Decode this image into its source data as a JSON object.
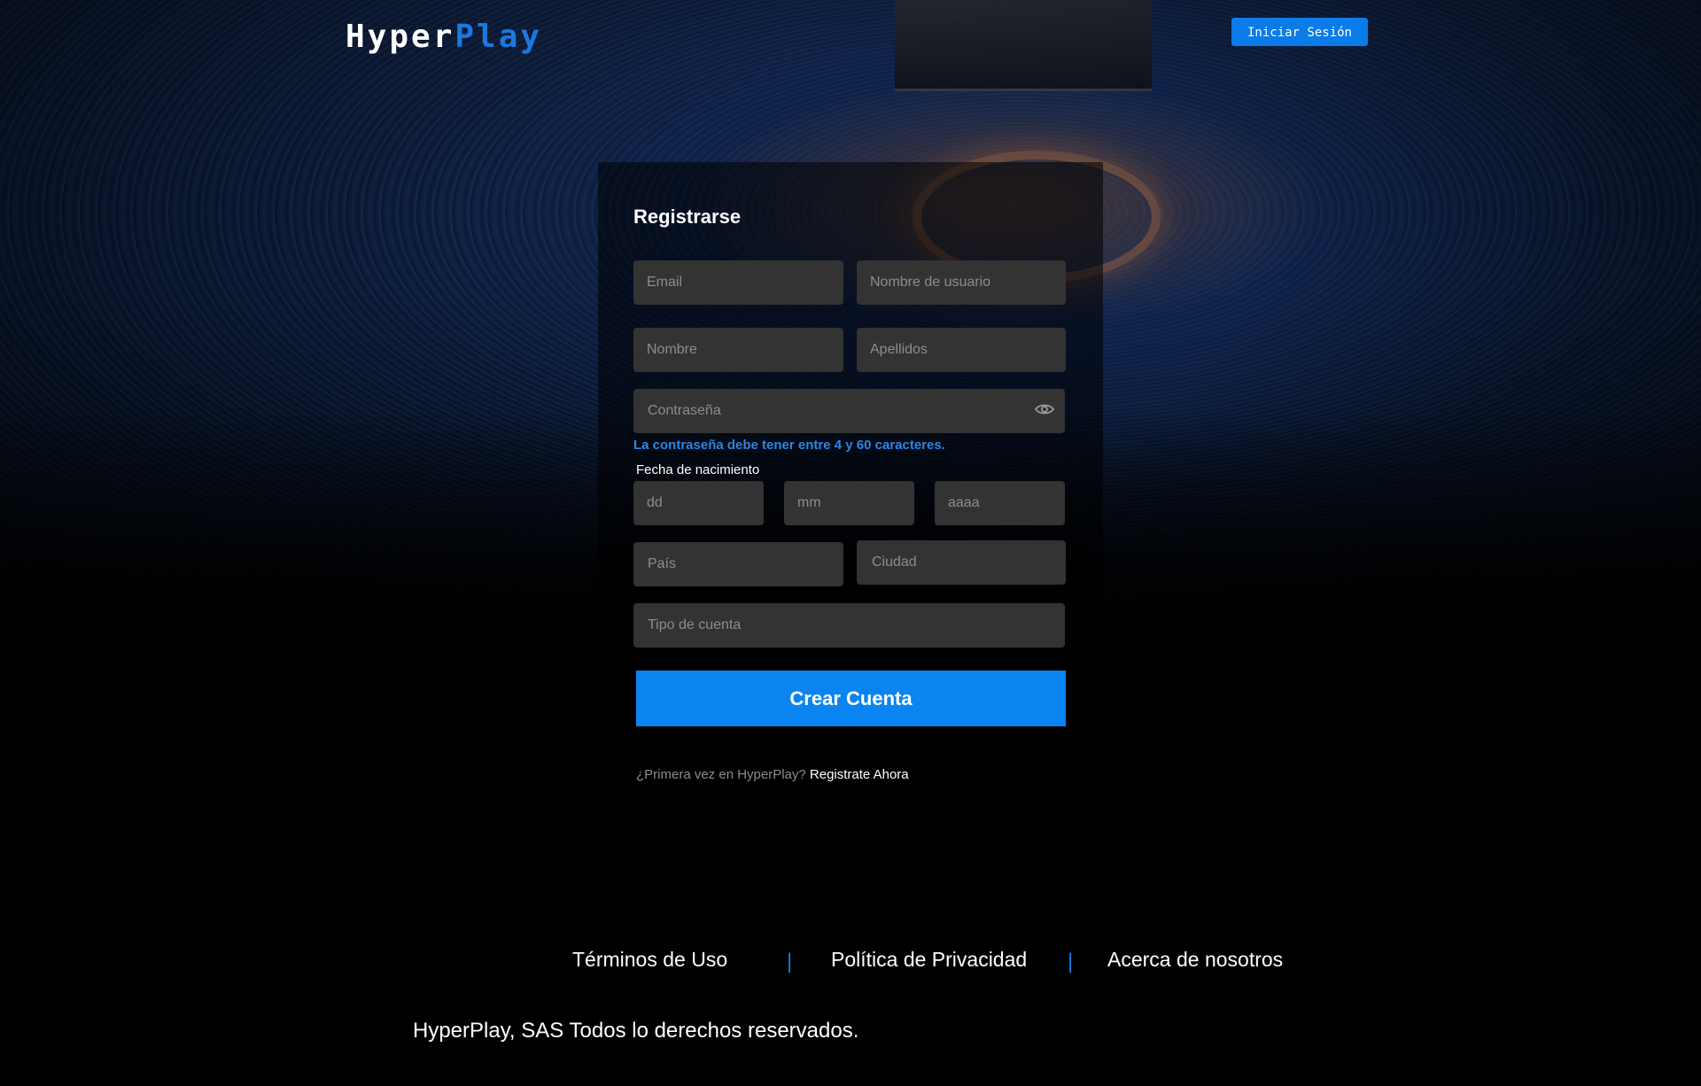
{
  "header": {
    "logo_part1": "Hyper",
    "logo_part2": "Play",
    "login_label": "Iniciar Sesión"
  },
  "form": {
    "title": "Registrarse",
    "fields": {
      "email": "Email",
      "username": "Nombre de usuario",
      "first_name": "Nombre",
      "last_name": "Apellidos",
      "password": "Contraseña",
      "day": "dd",
      "month": "mm",
      "year": "aaaa",
      "country": "País",
      "city": "Ciudad",
      "account_type": "Tipo de cuenta"
    },
    "password_hint": "La contraseña debe tener entre 4 y 60 caracteres.",
    "dob_label": "Fecha de nacimiento",
    "submit_label": "Crear Cuenta",
    "first_time_question": "¿Primera vez en HyperPlay?",
    "register_link": "Registrate Ahora"
  },
  "footer": {
    "links": [
      "Términos de Uso",
      "Política de Privacidad",
      "Acerca de nosotros"
    ],
    "separator": "|",
    "copyright": "HyperPlay, SAS Todos lo derechos reservados."
  },
  "colors": {
    "accent": "#0a84f0",
    "hint": "#2a86e8",
    "input_bg": "#333333"
  }
}
